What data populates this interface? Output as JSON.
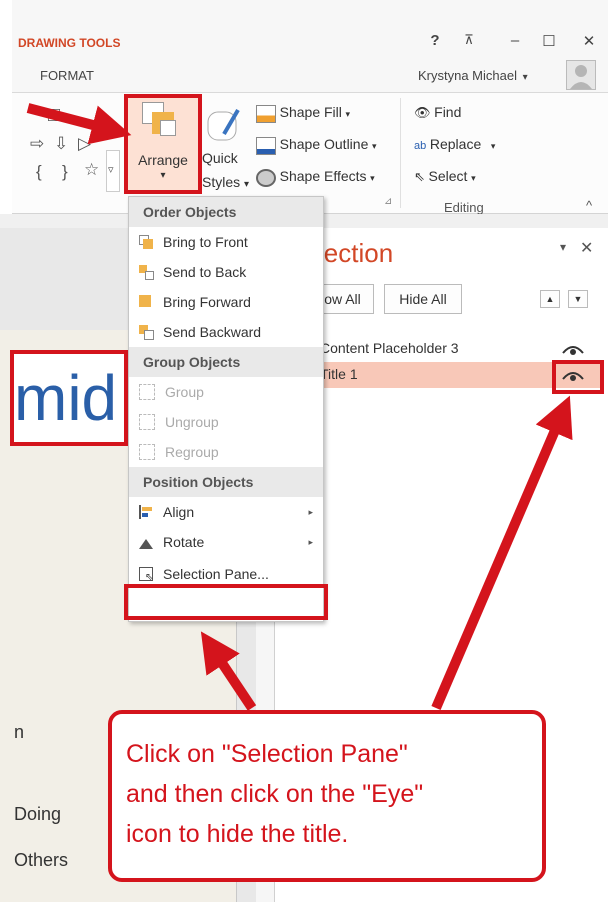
{
  "ribbon": {
    "context_tab": "DRAWING TOOLS",
    "tab_format": "FORMAT",
    "help_glyph": "?",
    "restore_glyph": "⊼",
    "minimize_glyph": "–",
    "maximize_glyph": "☐",
    "close_glyph": "✕",
    "user_name": "Krystyna Michael",
    "user_chevron": "▾",
    "shape_gallery": [
      "□",
      "⇨",
      "⇩",
      "▷",
      "{",
      "}",
      "☆",
      "▿"
    ],
    "arrange": {
      "label": "Arrange",
      "chevron": "▾"
    },
    "quick_styles": {
      "line1": "Quick",
      "line2": "Styles",
      "chevron": "▾"
    },
    "shape_fill": "Shape Fill",
    "shape_outline": "Shape Outline",
    "shape_effects": "Shape Effects",
    "dropdown_chevron": "▾",
    "group_launcher": "⊿",
    "find": "Find",
    "replace": "Replace",
    "select": "Select",
    "editing_label": "Editing",
    "collapse_ribbon": "^"
  },
  "arrange_menu": {
    "order_header": "Order Objects",
    "bring_to_front": "Bring to Front",
    "send_to_back": "Send to Back",
    "bring_forward": "Bring Forward",
    "send_backward": "Send Backward",
    "group_header": "Group Objects",
    "group": "Group",
    "ungroup": "Ungroup",
    "regroup": "Regroup",
    "position_header": "Position Objects",
    "align": "Align",
    "rotate": "Rotate",
    "submenu_arrow": "▸",
    "selection_pane": "Selection Pane..."
  },
  "slide": {
    "title_fragment": "mid",
    "text1": "n",
    "text2": "Doing",
    "text3": "Others"
  },
  "selection_pane": {
    "title": "lection",
    "menu_glyph": "▾",
    "close_glyph": "✕",
    "show_all": "ow All",
    "hide_all": "Hide All",
    "move_up": "▲",
    "move_down": "▼",
    "items": [
      {
        "label": "Content Placeholder 3"
      },
      {
        "label": "Title 1"
      }
    ]
  },
  "callout": {
    "line1": "Click on \"Selection Pane\"",
    "line2": "and then click on the \"Eye\"",
    "line3": "icon to hide the title."
  },
  "colors": {
    "annotation_red": "#d4141c",
    "accent_orange": "#d24726",
    "selected_row": "#f8c8b8"
  }
}
